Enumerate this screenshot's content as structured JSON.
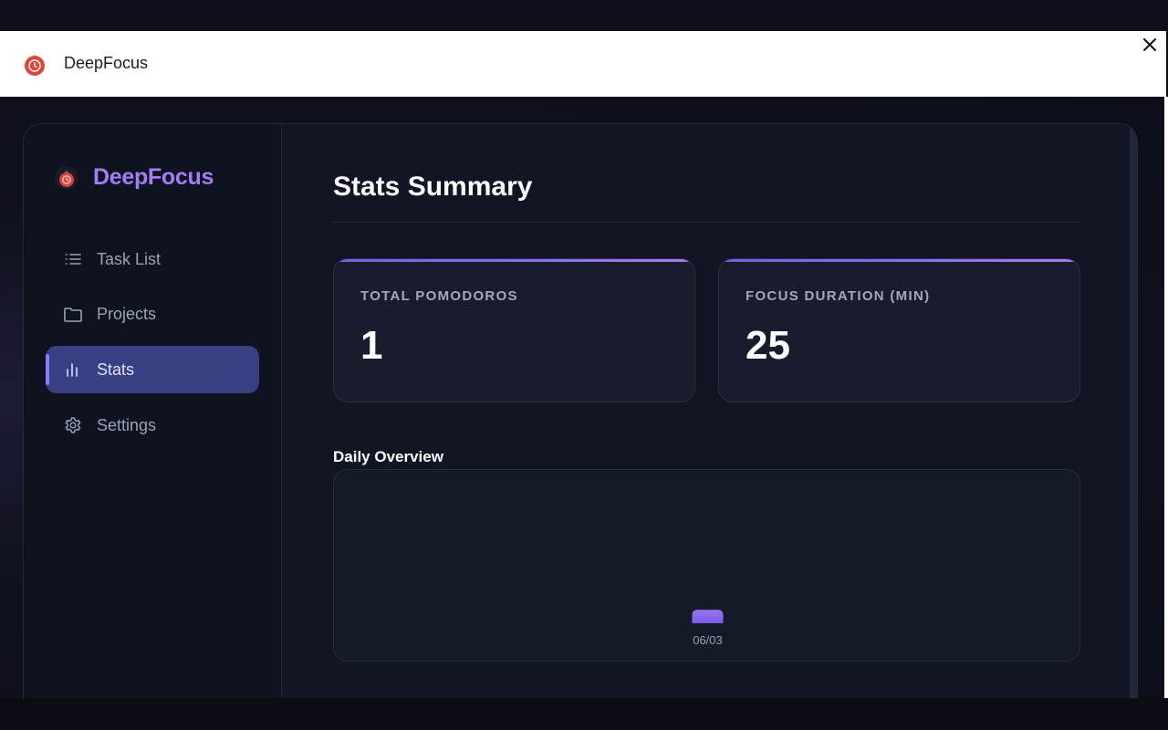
{
  "window": {
    "title": "DeepFocus",
    "app_icon": "tomato-icon",
    "close_icon": "close-icon"
  },
  "sidebar": {
    "brand": "DeepFocus",
    "brand_icon": "tomato-icon",
    "items": [
      {
        "label": "Task List",
        "icon": "list-icon",
        "active": false
      },
      {
        "label": "Projects",
        "icon": "folder-icon",
        "active": false
      },
      {
        "label": "Stats",
        "icon": "bar-chart-icon",
        "active": true
      },
      {
        "label": "Settings",
        "icon": "gear-icon",
        "active": false
      }
    ]
  },
  "main": {
    "title": "Stats Summary",
    "cards": [
      {
        "label": "TOTAL POMODOROS",
        "value": "1"
      },
      {
        "label": "FOCUS DURATION (MIN)",
        "value": "25"
      }
    ],
    "daily_title": "Daily Overview"
  },
  "colors": {
    "accent": "#a47cf3",
    "active_nav": "#383f82",
    "bar": "#8f6cf0",
    "background": "#111524"
  },
  "chart_data": {
    "type": "bar",
    "title": "Daily Overview",
    "categories": [
      "06/03"
    ],
    "values": [
      1
    ],
    "ylim": [
      0,
      10
    ]
  }
}
